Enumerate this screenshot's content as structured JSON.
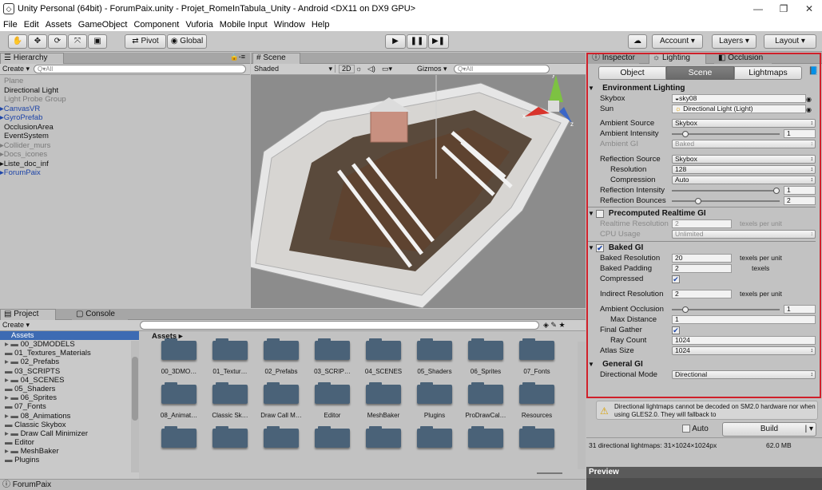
{
  "window": {
    "title": "Unity Personal (64bit) - ForumPaix.unity - Projet_RomeInTabula_Unity - Android <DX11 on DX9 GPU>",
    "min": "—",
    "max": "❐",
    "close": "✕"
  },
  "menu": [
    "File",
    "Edit",
    "Assets",
    "GameObject",
    "Component",
    "Vuforia",
    "Mobile Input",
    "Window",
    "Help"
  ],
  "toolbar": {
    "hand": "✋",
    "move": "✥",
    "rotate": "⟳",
    "scale": "⤧",
    "rect": "▣",
    "pivot": "Pivot",
    "global": "Global",
    "play": "▶",
    "pause": "❚❚",
    "step": "▶❚",
    "collab": "☁",
    "account": "Account",
    "layers": "Layers",
    "layout": "Layout"
  },
  "hierarchy": {
    "tab": "Hierarchy",
    "create": "Create",
    "search": "Q▾All",
    "items": [
      {
        "name": "Plane",
        "style": "gray"
      },
      {
        "name": "Directional Light",
        "style": "normal"
      },
      {
        "name": "Light Probe Group",
        "style": "gray"
      },
      {
        "name": "CanvasVR",
        "style": "blue",
        "fold": true
      },
      {
        "name": "GyroPrefab",
        "style": "blue",
        "fold": true
      },
      {
        "name": "OcclusionArea",
        "style": "normal"
      },
      {
        "name": "EventSystem",
        "style": "normal"
      },
      {
        "name": "Collider_murs",
        "style": "gray",
        "fold": true
      },
      {
        "name": "Docs_icones",
        "style": "gray",
        "fold": true
      },
      {
        "name": "Liste_doc_inf",
        "style": "normal",
        "fold": true
      },
      {
        "name": "ForumPaix",
        "style": "blue",
        "fold": true
      }
    ]
  },
  "scene": {
    "tab": "Scene",
    "shading": "Shaded",
    "mode2d": "2D",
    "gizmos": "Gizmos",
    "search": "Q▾All",
    "axis_x": "x",
    "axis_y": "y",
    "axis_z": "z"
  },
  "project": {
    "tab": "Project",
    "console_tab": "Console",
    "create": "Create",
    "breadcrumb": "Assets ▸",
    "root": "Assets",
    "tree": [
      "00_3DMODELS",
      "01_Textures_Materials",
      "02_Prefabs",
      "03_SCRIPTS",
      "04_SCENES",
      "05_Shaders",
      "06_Sprites",
      "07_Fonts",
      "08_Animations",
      "Classic Skybox",
      "Draw Call Minimizer",
      "Editor",
      "MeshBaker",
      "Plugins"
    ],
    "assets_row1": [
      "00_3DMO…",
      "01_Textur…",
      "02_Prefabs",
      "03_SCRIP…",
      "04_SCENES",
      "05_Shaders",
      "06_Sprites",
      "07_Fonts"
    ],
    "assets_row2": [
      "08_Animat…",
      "Classic Sk…",
      "Draw Call M…",
      "Editor",
      "MeshBaker",
      "Plugins",
      "ProDrawCal…",
      "Resources"
    ]
  },
  "status": {
    "text": "ForumPaix"
  },
  "inspector": {
    "tabs": {
      "inspector": "Inspector",
      "lighting": "Lighting",
      "occlusion": "Occlusion"
    },
    "subtabs": {
      "object": "Object",
      "scene": "Scene",
      "lightmaps": "Lightmaps"
    },
    "env": {
      "title": "Environment Lighting",
      "skybox_label": "Skybox",
      "skybox_val": "sky08",
      "sun_label": "Sun",
      "sun_val": "Directional Light (Light)",
      "amb_src_label": "Ambient Source",
      "amb_src_val": "Skybox",
      "amb_int_label": "Ambient Intensity",
      "amb_int_val": "1",
      "amb_gi_label": "Ambient GI",
      "amb_gi_val": "Baked",
      "refl_src_label": "Reflection Source",
      "refl_src_val": "Skybox",
      "res_label": "Resolution",
      "res_val": "128",
      "comp_label": "Compression",
      "comp_val": "Auto",
      "refl_int_label": "Reflection Intensity",
      "refl_int_val": "1",
      "refl_b_label": "Reflection Bounces",
      "refl_b_val": "2"
    },
    "precomp": {
      "title": "Precomputed Realtime GI",
      "rt_res_label": "Realtime Resolution",
      "rt_res_val": "2",
      "rt_unit": "texels per unit",
      "cpu_label": "CPU Usage",
      "cpu_val": "Unlimited"
    },
    "baked": {
      "title": "Baked GI",
      "res_label": "Baked Resolution",
      "res_val": "20",
      "res_unit": "texels per unit",
      "pad_label": "Baked Padding",
      "pad_val": "2",
      "pad_unit": "texels",
      "comp_label": "Compressed",
      "ind_label": "Indirect Resolution",
      "ind_val": "2",
      "ind_unit": "texels per unit",
      "ao_label": "Ambient Occlusion",
      "ao_val": "1",
      "maxd_label": "Max Distance",
      "maxd_val": "1",
      "fg_label": "Final Gather",
      "ray_label": "Ray Count",
      "ray_val": "1024",
      "atlas_label": "Atlas Size",
      "atlas_val": "1024"
    },
    "general": {
      "title": "General GI",
      "dir_label": "Directional Mode",
      "dir_val": "Directional"
    },
    "warning": "Directional lightmaps cannot be decoded on SM2.0 hardware nor when using GLES2.0. They will fallback to",
    "auto": "Auto",
    "build": "Build",
    "info": "31 directional lightmaps: 31×1024×1024px",
    "size": "62.0 MB",
    "preview": "Preview",
    "highlight": "#d0202a"
  }
}
